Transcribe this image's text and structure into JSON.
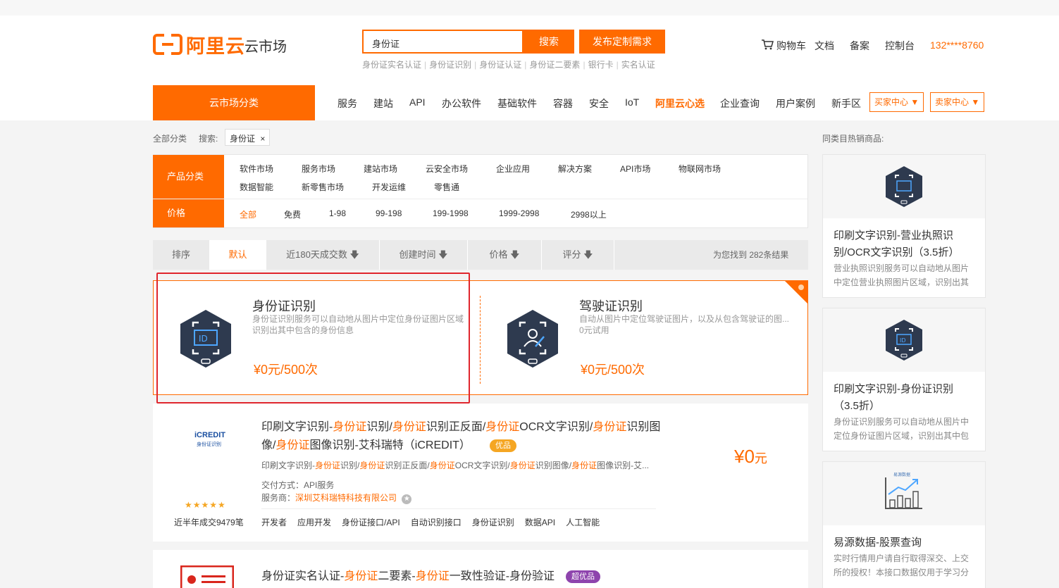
{
  "header": {
    "logo_text": "阿里云",
    "logo_sub": "云市场",
    "search_value": "身份证",
    "search_btn": "搜索",
    "post_btn": "发布定制需求",
    "hotwords": [
      "身份证实名认证",
      "身份证识别",
      "身份证认证",
      "身份证二要素",
      "银行卡",
      "实名认证"
    ],
    "cart": "购物车",
    "docs": "文档",
    "beian": "备案",
    "console": "控制台",
    "phone": "132****8760"
  },
  "nav": {
    "category_btn": "云市场分类",
    "items": [
      "服务",
      "建站",
      "API",
      "办公软件",
      "基础软件",
      "容器",
      "安全",
      "IoT",
      "阿里云心选",
      "企业查询",
      "用户案例",
      "新手区"
    ],
    "buyer_center": "买家中心",
    "seller_center": "卖家中心"
  },
  "breadcrumb": {
    "all": "全部分类",
    "search_label": "搜索:",
    "tag": "身份证",
    "tag_close": "×"
  },
  "filters": {
    "product_label": "产品分类",
    "product_items_row1": [
      "软件市场",
      "服务市场",
      "建站市场",
      "云安全市场",
      "企业应用",
      "解决方案",
      "API市场",
      "物联网市场"
    ],
    "product_items_row2": [
      "数据智能",
      "新零售市场",
      "开发运维",
      "零售通"
    ],
    "price_label": "价格",
    "price_items": [
      "全部",
      "免费",
      "1-98",
      "99-198",
      "199-1998",
      "1999-2998",
      "2998以上"
    ]
  },
  "sort": {
    "label": "排序",
    "items": [
      "默认",
      "近180天成交数",
      "创建时间",
      "价格",
      "评分"
    ],
    "found": "为您找到 282条结果"
  },
  "featured": [
    {
      "title": "身份证识别",
      "desc": "身份证识别服务可以自动地从图片中定位身份证图片区域识别出其中包含的身份信息",
      "price": "¥0元/500次",
      "icon": "id-card-scan-icon"
    },
    {
      "title": "驾驶证识别",
      "desc": "自动从图片中定位驾驶证图片，以及从包含驾驶证的图...",
      "trial": "0元试用",
      "price": "¥0元/500次",
      "icon": "driver-license-scan-icon"
    }
  ],
  "products": [
    {
      "logo_text": "iCREDIT",
      "logo_sub": "身份证识别",
      "title_parts": [
        "印刷文字识别-",
        "身份证",
        "识别/",
        "身份证",
        "识别正反面/",
        "身份证",
        "OCR文字识别/",
        "身份证",
        "识别图像/",
        "身份证",
        "图像识别-艾科瑞特（iCREDIT）"
      ],
      "badge": "优品",
      "subtitle_parts": [
        "印刷文字识别-",
        "身份证",
        "识别/",
        "身份证",
        "识别正反面/",
        "身份证",
        "OCR文字识别/",
        "身份证",
        "识别图像/",
        "身份证",
        "图像识别-艾..."
      ],
      "delivery": "交付方式：API服务",
      "provider_label": "服务商：",
      "provider": "深圳艾科瑞特科技有限公司",
      "price": "¥0",
      "price_unit": "元",
      "stars": "★★★★★",
      "sales": "近半年成交9479笔",
      "tags": [
        "开发者",
        "应用开发",
        "身份证接口/API",
        "自动识别接口",
        "身份证识别",
        "数据API",
        "人工智能"
      ]
    },
    {
      "title_parts": [
        "身份证实名认证-",
        "身份证",
        "二要素-",
        "身份证",
        "一致性验证-身份验证"
      ],
      "badge": "超优品"
    }
  ],
  "sidebar": {
    "title": "同类目热销商品:",
    "items": [
      {
        "title": "印刷文字识别-营业执照识别/OCR文字识别（3.5折）",
        "desc": "营业执照识别服务可以自动地从图片中定位营业执照图片区域，识别出其",
        "icon": "license-scan-icon"
      },
      {
        "title": "印刷文字识别-身份证识别（3.5折）",
        "desc": "身份证识别服务可以自动地从图片中定位身份证图片区域，识别出其中包",
        "icon": "id-card-scan-icon"
      },
      {
        "title": "易源数据-股票查询",
        "desc": "实时行情用户请自行取得深交、上交所的授权！本接口数据仅用于学习分",
        "icon": "stock-chart-icon",
        "logo_text": "易源数据"
      }
    ]
  },
  "colors": {
    "accent": "#ff6a00",
    "highlight_box": "#e0262d",
    "hex_icon": "#2e3a4f"
  }
}
